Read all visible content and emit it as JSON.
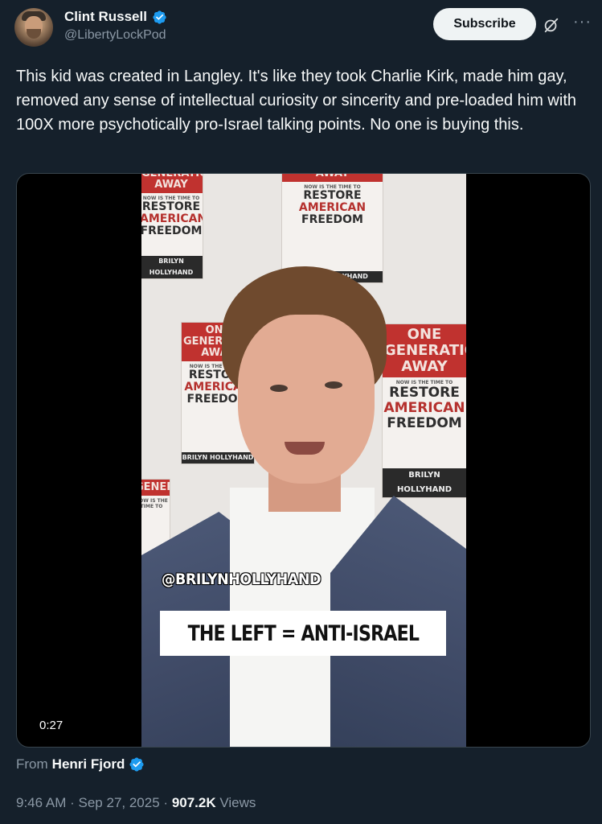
{
  "author": {
    "display_name": "Clint Russell",
    "handle": "@LibertyLockPod",
    "verified_icon": "verified-badge-icon",
    "avatar_icon": "avatar"
  },
  "actions": {
    "subscribe_label": "Subscribe",
    "grok_icon": "grok-icon",
    "more_icon": "more-icon"
  },
  "tweet": {
    "text": "This kid was created in Langley. It's like they took Charlie Kirk, made him gay, removed any sense of intellectual curiosity or sincerity and pre-loaded him with 100X more psychotically pro-Israel talking points. No one is buying this."
  },
  "video": {
    "duration": "0:27",
    "caption_handle": "@BRILYNHOLLYHAND",
    "caption_main": "THE LEFT = ANTI-ISRAEL",
    "backdrop_books": {
      "red_line_1": "ONE",
      "red_line_2": "GENERATION",
      "red_line_3": "AWAY",
      "subtitle": "NOW IS THE TIME TO",
      "line_1": "RESTORE",
      "line_2": "AMERICAN",
      "line_3": "FREEDOM",
      "author": "BRILYN HOLLYHAND"
    }
  },
  "source": {
    "prefix": "From",
    "name": "Henri Fjord"
  },
  "meta": {
    "time": "9:46 AM",
    "separator": "·",
    "date": "Sep 27, 2025",
    "views_count": "907.2K",
    "views_label": "Views"
  },
  "colors": {
    "background": "#15202b",
    "verified_blue": "#1d9bf0",
    "secondary_text": "#8b98a5"
  }
}
